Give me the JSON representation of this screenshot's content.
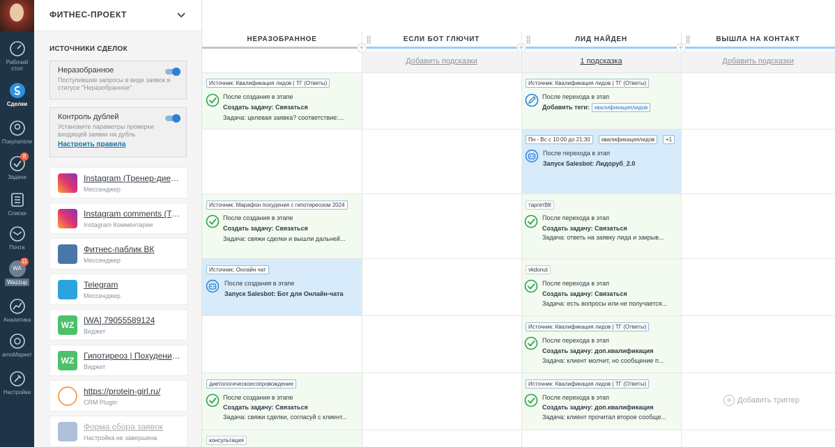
{
  "nav": {
    "items": [
      {
        "label": "Рабочий стол",
        "icon": "dashboard-icon"
      },
      {
        "label": "Сделки",
        "icon": "deals-icon"
      },
      {
        "label": "Покупатели",
        "icon": "customers-icon"
      },
      {
        "label": "Задачи",
        "icon": "tasks-icon",
        "badge": "8"
      },
      {
        "label": "Списки",
        "icon": "lists-icon"
      },
      {
        "label": "Почта",
        "icon": "mail-icon"
      },
      {
        "label": "Wazzup",
        "icon": "wazzup-icon",
        "badge": "11",
        "avatar_text": "WA"
      },
      {
        "label": "Аналитика",
        "icon": "analytics-icon"
      },
      {
        "label": "amoМаркет",
        "icon": "market-icon"
      },
      {
        "label": "Настройки",
        "icon": "settings-icon"
      }
    ]
  },
  "sidebar": {
    "pipeline_title": "ФИТНЕС-ПРОЕКТ",
    "sources_title": "ИСТОЧНИКИ СДЕЛОК",
    "unsorted": {
      "title": "Неразобранное",
      "subtitle": "Поступившие запросы в виде заявок в статусе \"Неразобранное\"",
      "enabled": true
    },
    "duplicates": {
      "title": "Контроль дублей",
      "subtitle": "Установите параметры проверки входящей заявки на дубль",
      "link": "Настроить правила",
      "enabled": true
    },
    "sources": [
      {
        "name": "Instagram (Тренер-диетолог...",
        "sub": "Мессенджер",
        "kind": "ig"
      },
      {
        "name": "Instagram comments (Трен...",
        "sub": "Instagram Комментарии",
        "kind": "ig"
      },
      {
        "name": "Фитнес-паблик ВК",
        "sub": "Мессенджер",
        "kind": "vk"
      },
      {
        "name": "Telegram",
        "sub": "Мессенджер",
        "kind": "tg"
      },
      {
        "name": "[WA] 79055589124",
        "sub": "Виджет",
        "kind": "wz",
        "logo_text": "WZ"
      },
      {
        "name": "Гипотиреоз | Похудение |...",
        "sub": "Виджет",
        "kind": "wz",
        "logo_text": "WZ"
      },
      {
        "name": "https://protein-girl.ru/",
        "sub": "CRM Plugin",
        "kind": "crm"
      },
      {
        "name": "Форма сбора заявок",
        "sub": "Настройка не завершена",
        "kind": "vk",
        "dim": true
      }
    ]
  },
  "columns": [
    {
      "title": "НЕРАЗОБРАННОЕ",
      "color": "#c4c4c4",
      "hint": ""
    },
    {
      "title": "ЕСЛИ БОТ ГЛЮЧИТ",
      "color": "#99ccfd",
      "hint": "Добавить подсказки"
    },
    {
      "title": "ЛИД НАЙДЕН",
      "color": "#99ccfd",
      "hint": "1 подсказка"
    },
    {
      "title": "ВЫШЛА НА КОНТАКТ",
      "color": "#99ccfd",
      "hint": "Добавить подсказки"
    }
  ],
  "triggers": {
    "c0r0": {
      "tag": "Источник: Квалификация лидов | ТГ (Ответы)",
      "l1": "После создания в этапе",
      "l2": "Создать задачу: Связаться",
      "l3": "Задача: целевая заявка? соответствие:..."
    },
    "c2r0": {
      "tag": "Источник: Квалификация лидов | ТГ (Ответы)",
      "l1": "После перехода в этап",
      "l2": "Добавить теги:",
      "tag2": "квалификациялидов"
    },
    "c2r1": {
      "tag": "Пн - Вс с 10:00 до 21:30",
      "tag2": "квалификациялидов",
      "tag3": "+1",
      "l1": "После перехода в этап",
      "l2": "Запуск Salesbot: Лидоруб_2.0"
    },
    "c0r2": {
      "tag": "Источник: Марафон похудения с гипотиреозом 2024",
      "l1": "После создания в этапе",
      "l2": "Создать задачу: Связаться",
      "l3": "Задача: свяжи сделки и вышли дальней..."
    },
    "c2r2": {
      "tag": "таргетВК",
      "l1": "После перехода в этап",
      "l2": "Создать задачу: Связаться",
      "l3": "Задача: ответь на заявку лида и закрыв..."
    },
    "c0r3": {
      "tag": "Источник: Онлайн чат",
      "l1": "После создания в этапе",
      "l2": "Запуск Salesbot: Бот для Онлайн-чата"
    },
    "c2r3": {
      "tag": "vkdonut",
      "l1": "После перехода в этап",
      "l2": "Создать задачу: Связаться",
      "l3": "Задача: есть вопросы или не получается..."
    },
    "c2r4": {
      "tag": "Источник: Квалификация лидов | ТГ (Ответы)",
      "l1": "После перехода в этап",
      "l2": "Создать задачу: доп.квалификация",
      "l3": "Задача: клиент молчит, но сообщение п..."
    },
    "c0r5": {
      "tag": "диетологическоесопровождение",
      "l1": "После создания в этапе",
      "l2": "Создать задачу: Связаться",
      "l3": "Задача: свяжи сделки, согласуй с клиент..."
    },
    "c2r5": {
      "tag": "Источник: Квалификация лидов | ТГ (Ответы)",
      "l1": "После перехода в этап",
      "l2": "Создать задачу: доп.квалификация",
      "l3": "Задача: клиент прочитал второе сообще..."
    },
    "c0r6": {
      "tag": "консультация"
    }
  },
  "add_trigger_label": "Добавить триггер"
}
